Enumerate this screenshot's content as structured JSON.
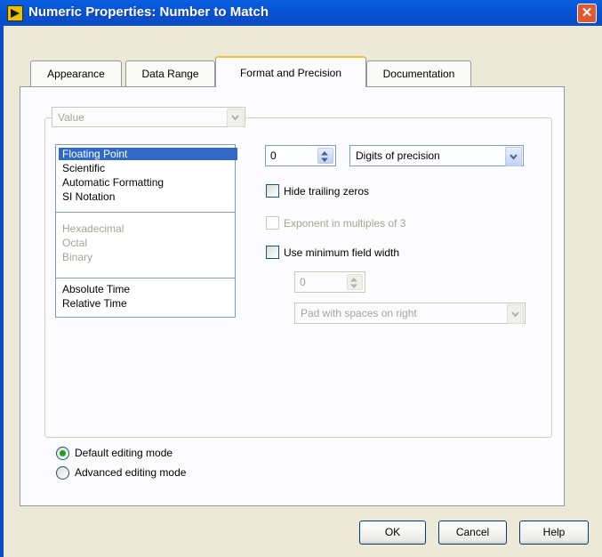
{
  "window": {
    "title": "Numeric Properties: Number to Match",
    "close_glyph": "✕"
  },
  "tabs": [
    {
      "label": "Appearance"
    },
    {
      "label": "Data Range"
    },
    {
      "label": "Format and Precision"
    },
    {
      "label": "Documentation"
    }
  ],
  "active_tab": "Format and Precision",
  "value_select": {
    "value": "Value"
  },
  "format_list": {
    "group1": [
      "Floating Point",
      "Scientific",
      "Automatic Formatting",
      "SI Notation"
    ],
    "group2": [
      "Hexadecimal",
      "Octal",
      "Binary"
    ],
    "group3": [
      "Absolute Time",
      "Relative Time"
    ],
    "selected": "Floating Point"
  },
  "precision": {
    "digits_value": "0",
    "type_value": "Digits of precision"
  },
  "options": {
    "hide_trailing_zeros": "Hide trailing zeros",
    "exponent_multiples_3": "Exponent in multiples of 3",
    "use_min_field_width": "Use minimum field width"
  },
  "min_width": {
    "value": "0",
    "padding_value": "Pad with spaces on right"
  },
  "editing_mode": {
    "default_label": "Default editing mode",
    "advanced_label": "Advanced editing mode",
    "selected": "default"
  },
  "buttons": {
    "ok": "OK",
    "cancel": "Cancel",
    "help": "Help"
  },
  "colors": {
    "title_bar": "#0554d6",
    "selection": "#316ac5",
    "active_tab_accent": "#f0c040",
    "radio_dot": "#21a121",
    "close_button": "#e0592f"
  }
}
